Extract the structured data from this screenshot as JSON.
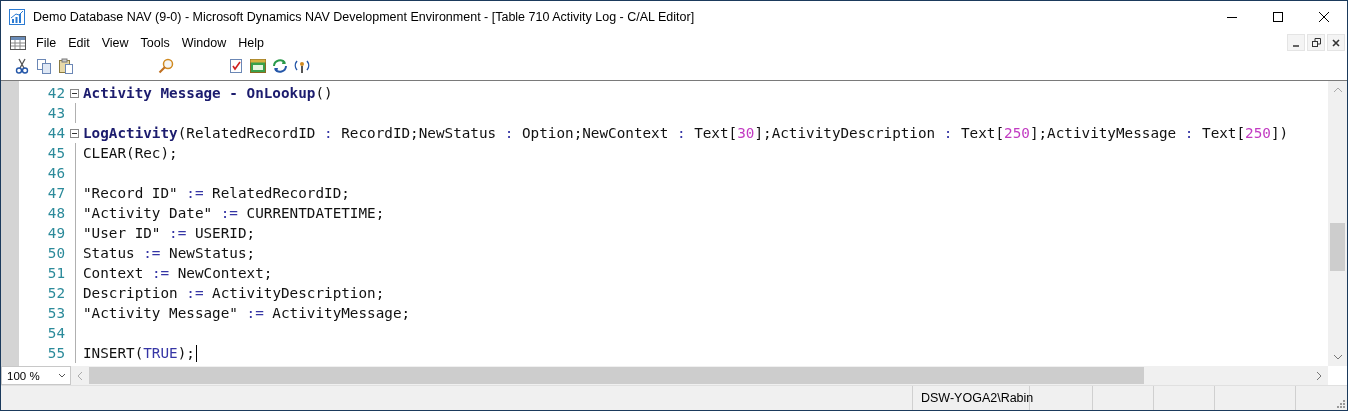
{
  "window": {
    "title": "Demo Database NAV (9-0) - Microsoft Dynamics NAV Development Environment - [Table 710 Activity Log - C/AL Editor]"
  },
  "menu": [
    "File",
    "Edit",
    "View",
    "Tools",
    "Window",
    "Help"
  ],
  "editor": {
    "lines": [
      {
        "number": "42",
        "foldable": true,
        "tokens": [
          {
            "kind": "bold",
            "text": "Activity Message - OnLookup"
          },
          {
            "kind": "plain",
            "text": "()"
          }
        ]
      },
      {
        "number": "43",
        "foldable": false
      },
      {
        "number": "44",
        "foldable": true,
        "tokens": [
          {
            "kind": "bold",
            "text": "LogActivity"
          },
          {
            "kind": "plain",
            "text": "(RelatedRecordID "
          },
          {
            "kind": "keyword",
            "text": ":"
          },
          {
            "kind": "plain",
            "text": " RecordID;NewStatus "
          },
          {
            "kind": "keyword",
            "text": ":"
          },
          {
            "kind": "plain",
            "text": " Option;NewContext "
          },
          {
            "kind": "keyword",
            "text": ":"
          },
          {
            "kind": "plain",
            "text": " Text["
          },
          {
            "kind": "number",
            "text": "30"
          },
          {
            "kind": "plain",
            "text": "];ActivityDescription "
          },
          {
            "kind": "keyword",
            "text": ":"
          },
          {
            "kind": "plain",
            "text": " Text["
          },
          {
            "kind": "number",
            "text": "250"
          },
          {
            "kind": "plain",
            "text": "];ActivityMessage "
          },
          {
            "kind": "keyword",
            "text": ":"
          },
          {
            "kind": "plain",
            "text": " Text["
          },
          {
            "kind": "number",
            "text": "250"
          },
          {
            "kind": "plain",
            "text": "])"
          }
        ]
      },
      {
        "number": "45",
        "foldable": false,
        "tokens": [
          {
            "kind": "plain",
            "text": "CLEAR(Rec);"
          }
        ]
      },
      {
        "number": "46",
        "foldable": false
      },
      {
        "number": "47",
        "foldable": false,
        "tokens": [
          {
            "kind": "plain",
            "text": "\"Record ID\" "
          },
          {
            "kind": "keyword",
            "text": ":="
          },
          {
            "kind": "plain",
            "text": " RelatedRecordID;"
          }
        ]
      },
      {
        "number": "48",
        "foldable": false,
        "tokens": [
          {
            "kind": "plain",
            "text": "\"Activity Date\" "
          },
          {
            "kind": "keyword",
            "text": ":="
          },
          {
            "kind": "plain",
            "text": " CURRENTDATETIME;"
          }
        ]
      },
      {
        "number": "49",
        "foldable": false,
        "tokens": [
          {
            "kind": "plain",
            "text": "\"User ID\" "
          },
          {
            "kind": "keyword",
            "text": ":="
          },
          {
            "kind": "plain",
            "text": " USERID;"
          }
        ]
      },
      {
        "number": "50",
        "foldable": false,
        "tokens": [
          {
            "kind": "plain",
            "text": "Status "
          },
          {
            "kind": "keyword",
            "text": ":="
          },
          {
            "kind": "plain",
            "text": " NewStatus;"
          }
        ]
      },
      {
        "number": "51",
        "foldable": false,
        "tokens": [
          {
            "kind": "plain",
            "text": "Context "
          },
          {
            "kind": "keyword",
            "text": ":="
          },
          {
            "kind": "plain",
            "text": " NewContext;"
          }
        ]
      },
      {
        "number": "52",
        "foldable": false,
        "tokens": [
          {
            "kind": "plain",
            "text": "Description "
          },
          {
            "kind": "keyword",
            "text": ":="
          },
          {
            "kind": "plain",
            "text": " ActivityDescription;"
          }
        ]
      },
      {
        "number": "53",
        "foldable": false,
        "tokens": [
          {
            "kind": "plain",
            "text": "\"Activity Message\" "
          },
          {
            "kind": "keyword",
            "text": ":="
          },
          {
            "kind": "plain",
            "text": " ActivityMessage;"
          }
        ]
      },
      {
        "number": "54",
        "foldable": false
      },
      {
        "number": "55",
        "foldable": false,
        "cursor": true,
        "tokens": [
          {
            "kind": "plain",
            "text": "INSERT("
          },
          {
            "kind": "keyword",
            "text": "TRUE"
          },
          {
            "kind": "plain",
            "text": ");"
          }
        ]
      }
    ]
  },
  "zoom": {
    "value": "100 %"
  },
  "status_bar": {
    "user": "DSW-YOGA2\\Rabin"
  }
}
